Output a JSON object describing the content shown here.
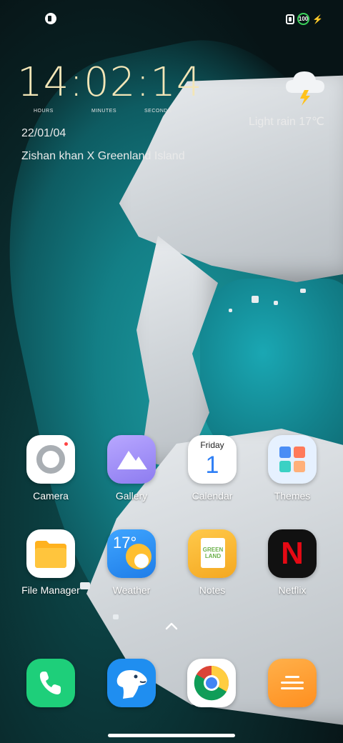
{
  "status_bar": {
    "left_icon": "notification-app-icon",
    "right_icons": [
      "nfc-icon",
      "battery-icon",
      "charging-icon"
    ],
    "battery_level": "100",
    "battery_color": "#3ad15a"
  },
  "clock": {
    "time": "14:02:14",
    "units": {
      "hours": "HOURS",
      "minutes": "MINUTES",
      "seconds": "SECONDS"
    },
    "date": "22/01/04",
    "caption": "Zishan khan X Greenland Island",
    "time_color": "#f3e6b7"
  },
  "weather": {
    "icon": "cloud-lightning-icon",
    "text": "Light rain 17℃"
  },
  "apps": [
    {
      "label": "Camera",
      "icon": "camera-icon"
    },
    {
      "label": "Gallery",
      "icon": "gallery-icon"
    },
    {
      "label": "Calendar",
      "icon": "calendar-icon",
      "day": "Friday",
      "date_num": "1"
    },
    {
      "label": "Themes",
      "icon": "themes-icon"
    },
    {
      "label": "File Manager",
      "icon": "folder-icon"
    },
    {
      "label": "Weather",
      "icon": "weather-app-icon",
      "temp": "17°"
    },
    {
      "label": "Notes",
      "icon": "notes-icon",
      "note_text": "GREEN LAND"
    },
    {
      "label": "Netflix",
      "icon": "netflix-icon",
      "letter": "N"
    }
  ],
  "dock": [
    {
      "icon": "phone-icon"
    },
    {
      "icon": "polar-bear-icon"
    },
    {
      "icon": "chrome-icon"
    },
    {
      "icon": "menu-app-icon"
    }
  ]
}
